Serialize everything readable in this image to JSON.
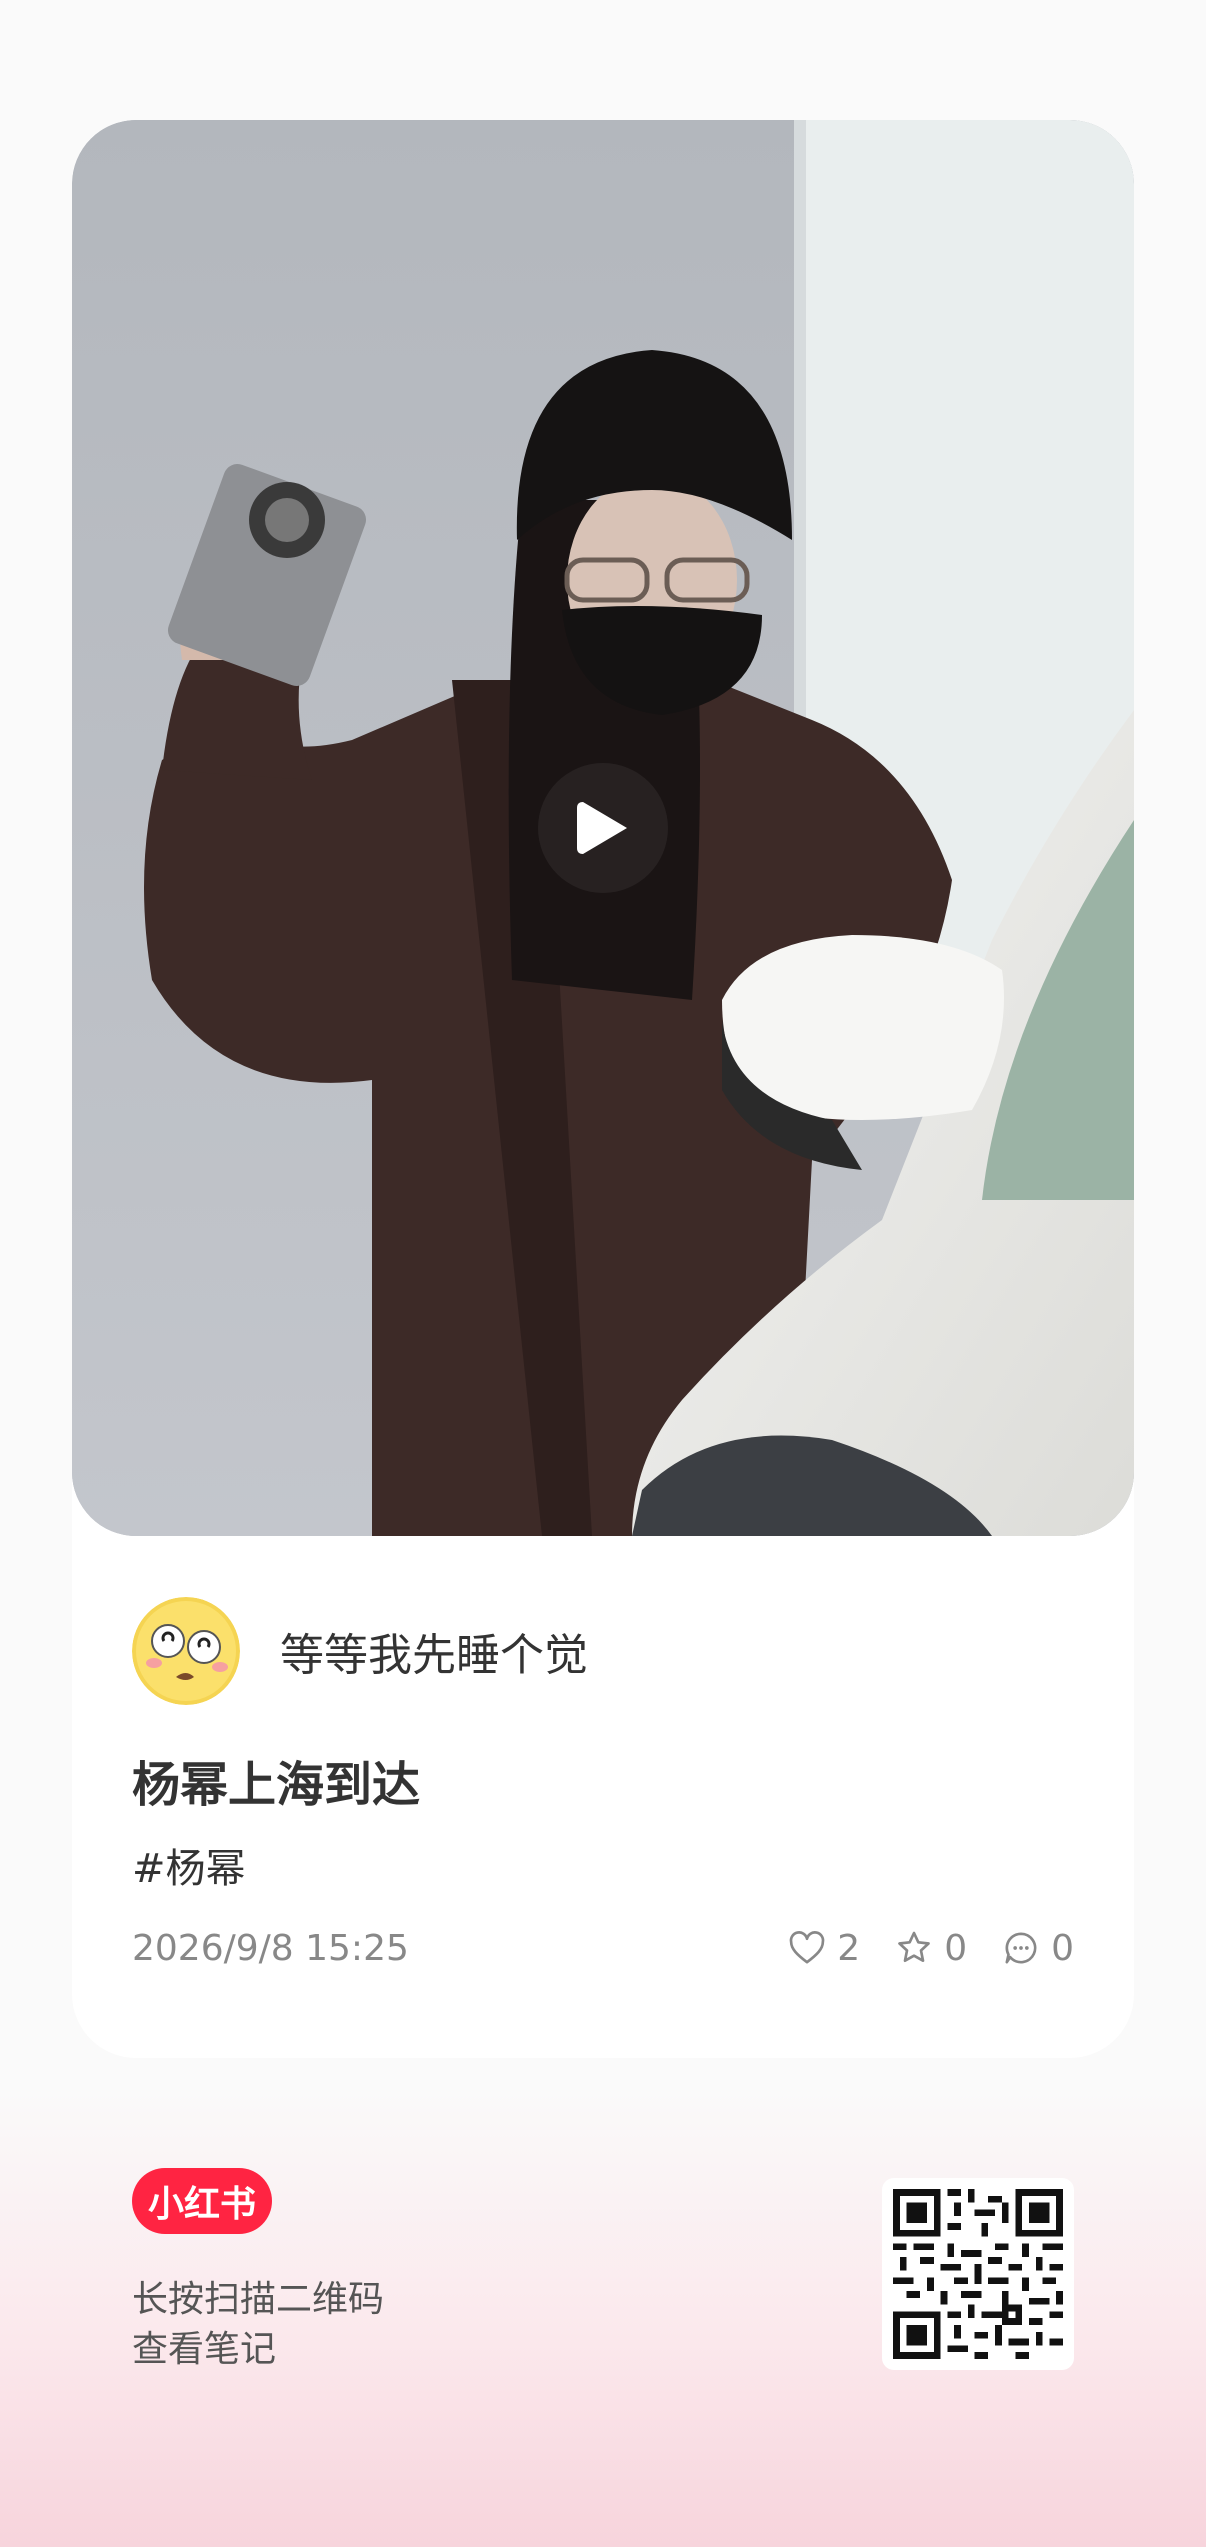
{
  "post": {
    "author_name": "等等我先睡个觉",
    "avatar_icon": "dizzy-emoji-avatar",
    "title": "杨幂上海到达",
    "tag": "#杨幂",
    "date": "2026/9/8 15:25",
    "likes": "2",
    "favorites": "0",
    "comments": "0",
    "media_type": "video"
  },
  "footer": {
    "brand": "小红书",
    "hint_line1": "长按扫描二维码",
    "hint_line2": "查看笔记"
  },
  "icons": {
    "play": "play-icon",
    "like": "heart-icon",
    "favorite": "star-icon",
    "comment": "comment-bubble-icon",
    "qr": "qr-code"
  },
  "colors": {
    "brand_red": "#ff2442",
    "card_bg": "#ffffff",
    "muted_text": "#888888",
    "gradient_bottom": "#f7d4dc"
  }
}
